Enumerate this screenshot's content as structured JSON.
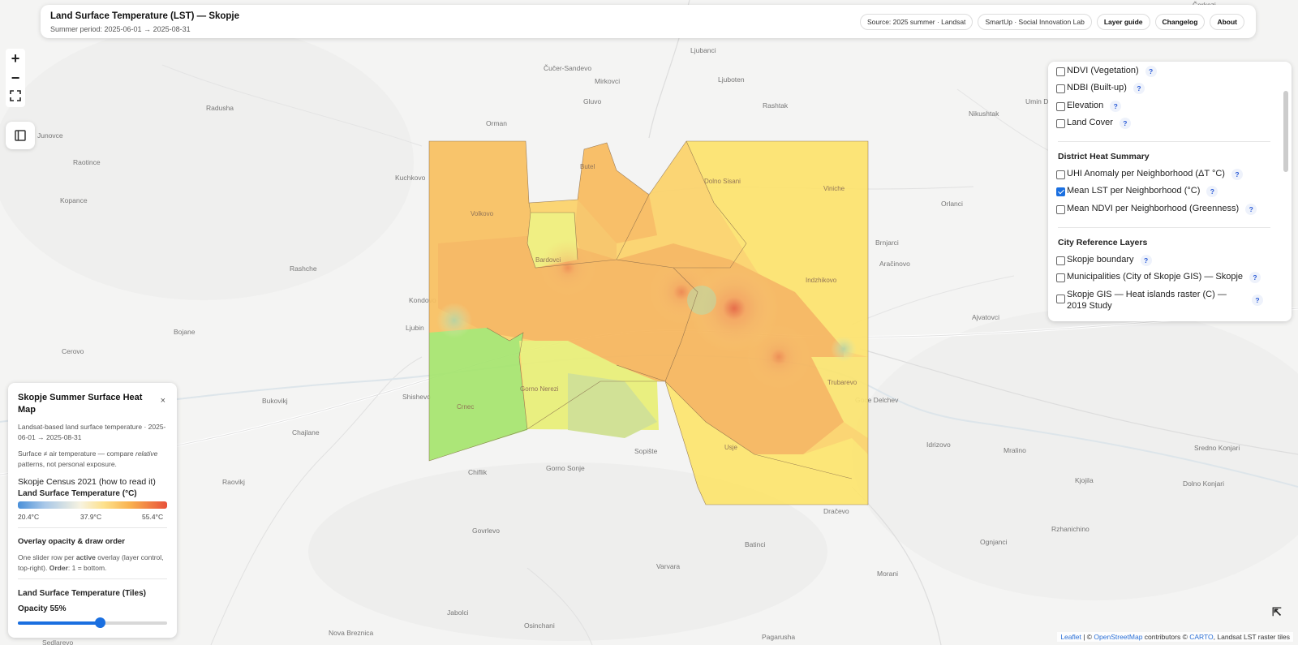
{
  "header": {
    "title": "Land Surface Temperature (LST) — Skopje",
    "subtitle": "Summer period: 2025-06-01 → 2025-08-31",
    "buttons": {
      "source": "Source: 2025 summer · Landsat",
      "smartup": "SmartUp · Social Innovation Lab",
      "layer_guide": "Layer guide",
      "changelog": "Changelog",
      "about": "About"
    }
  },
  "map_controls": {
    "zoom_in": "+",
    "zoom_out": "−",
    "fullscreen": "⛶"
  },
  "places": {
    "cucer": "Čučer-Sandevo",
    "ljubanci": "Ljubanci",
    "mirkovci": "Mirkovci",
    "ljuboten": "Ljuboten",
    "radusha": "Radusha",
    "gluvo": "Gluvo",
    "rashtak": "Rashtak",
    "umin": "Umin Do",
    "nikushtak": "Nikushtak",
    "junovce": "Junovce",
    "orman": "Orman",
    "raotince": "Raotince",
    "kuchkovo": "Kuchkovo",
    "kopance": "Kopance",
    "orlanci": "Orlanci",
    "rashche": "Rashche",
    "brnjarci": "Brnjarci",
    "aracinovo": "Aračinovo",
    "bojane": "Bojane",
    "ajvatovci": "Ajvatovci",
    "cerovo": "Cerovo",
    "bukovikj": "Bukovikj",
    "chajlane": "Chajlane",
    "sopishte": "Sopište",
    "idrizovo": "Idrizovo",
    "mralino": "Mralino",
    "raovikj": "Raovikj",
    "chiflik": "Chiflik",
    "gornosonje": "Gorno Sonje",
    "kjojila": "Kjojila",
    "dolnokonjari": "Dolno Konjari",
    "gorenkonjari": "Sredno Konjari",
    "govrlevo": "Govrlevo",
    "dracevo": "Dračevo",
    "rzhanichino": "Rzhanichino",
    "batinci": "Batinci",
    "ognjanci": "Ognjanci",
    "varvara": "Varvara",
    "morani": "Morani",
    "jabolci": "Jabolci",
    "osinchani": "Osinchani",
    "pagarusha": "Pagarusha",
    "novabrez": "Nova Breznica",
    "sedlarevo": "Sedlarevo",
    "cherkezi": "Čerkezi",
    "kondovo": "Kondovo",
    "ljubin": "Ljubin",
    "shishevo": "Shishevo",
    "godelchev": "Goce Delchev",
    "trubarevo": "Trubarevo",
    "saraj_in": "Crnec",
    "gornonerezi": "Gorno Nerezi",
    "bardovci": "Bardovci",
    "volkovo": "Volkovo",
    "usje": "Usje",
    "indzhikovo": "Indzhikovo",
    "vinicha": "Viniche",
    "butel": "Butel",
    "dolnodisani": "Dolno Sisani"
  },
  "layer_control": {
    "base_layers": [
      {
        "label": "NDVI (Vegetation)",
        "checked": false
      },
      {
        "label": "NDBI (Built-up)",
        "checked": false
      },
      {
        "label": "Elevation",
        "checked": false
      },
      {
        "label": "Land Cover",
        "checked": false
      }
    ],
    "district_heading": "District Heat Summary",
    "district_layers": [
      {
        "label": "UHI Anomaly per Neighborhood (ΔT °C)",
        "checked": false
      },
      {
        "label": "Mean LST per Neighborhood (°C)",
        "checked": true
      },
      {
        "label": "Mean NDVI per Neighborhood (Greenness)",
        "checked": false
      }
    ],
    "city_heading": "City Reference Layers",
    "city_layers": [
      {
        "label": "Skopje boundary",
        "checked": false
      },
      {
        "label": "Municipalities (City of Skopje GIS) — Skopje",
        "checked": false
      },
      {
        "label": "Skopje GIS — Heat islands raster (C) — 2019 Study",
        "checked": false
      }
    ],
    "help_glyph": "?"
  },
  "info_panel": {
    "title": "Skopje Summer Surface Heat Map",
    "close": "×",
    "description": "Landsat-based land surface temperature · 2025-06-01 → 2025-08-31",
    "note_prefix": "Surface ≠ air temperature — compare ",
    "note_em": "relative",
    "note_suffix": " patterns, not personal exposure.",
    "census_link": "Skopje Census 2021 (how to read it)",
    "legend_title": "Land Surface Temperature (°C)",
    "legend_min": "20.4°C",
    "legend_mid": "37.9°C",
    "legend_max": "55.4°C",
    "opacity_heading": "Overlay opacity & draw order",
    "opacity_help_1": "One slider row per ",
    "opacity_help_bold": "active",
    "opacity_help_2": " overlay (layer control, top-right). ",
    "opacity_help_order": "Order",
    "opacity_help_3": ": 1 = bottom.",
    "layer_name": "Land Surface Temperature (Tiles)",
    "opacity_label": "Opacity 55%",
    "opacity_value": 0.55
  },
  "attribution": {
    "leaflet": "Leaflet",
    "sep": " | © ",
    "osm": "OpenStreetMap",
    "contrib": " contributors © ",
    "carto": "CARTO",
    "tail": ", Landsat LST raster tiles"
  },
  "colors": {
    "accent": "#1a6fe0",
    "hot": "#e8513a",
    "cool": "#4a90d9",
    "green": "#a8e06a"
  }
}
